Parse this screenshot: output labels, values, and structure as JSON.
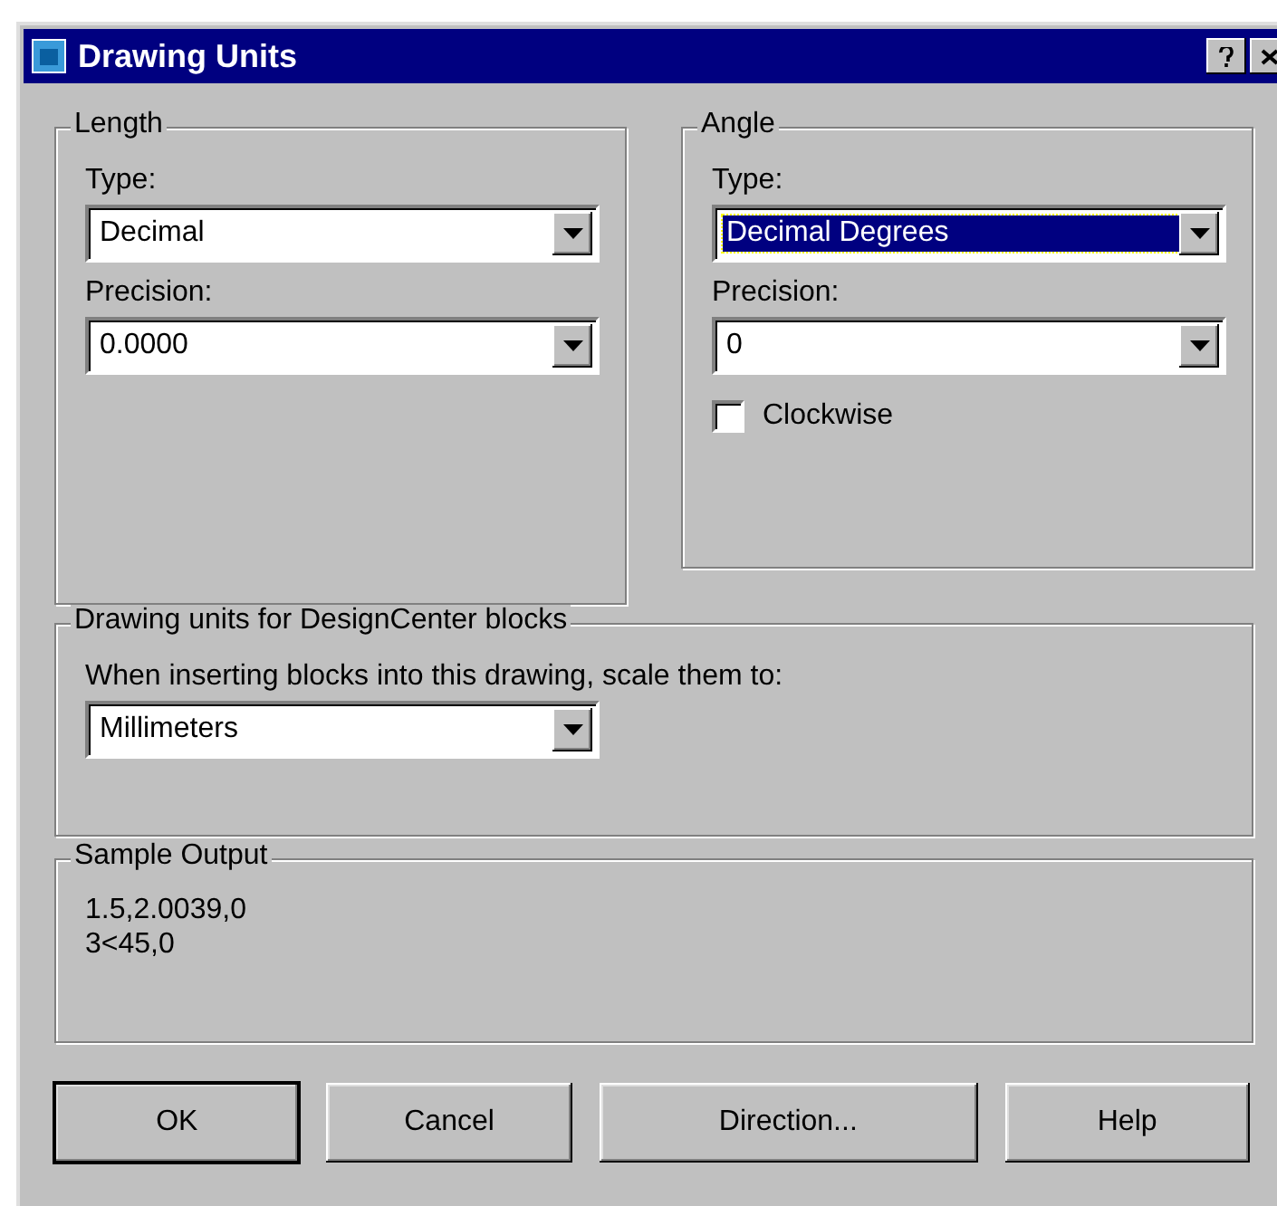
{
  "window": {
    "title": "Drawing Units"
  },
  "length": {
    "title": "Length",
    "fields": [
      {
        "label": "Type:",
        "value": "Decimal",
        "selected": false
      },
      {
        "label": "Precision:",
        "value": "0.0000",
        "selected": false
      }
    ]
  },
  "angle": {
    "title": "Angle",
    "fields": [
      {
        "label": "Type:",
        "value": "Decimal Degrees",
        "selected": true
      },
      {
        "label": "Precision:",
        "value": "0",
        "selected": false
      }
    ],
    "clockwise": {
      "label": "Clockwise",
      "checked": false
    }
  },
  "designcenter": {
    "title": "Drawing units for DesignCenter blocks",
    "label": "When inserting blocks into this drawing, scale them to:",
    "value": "Millimeters",
    "selected": false
  },
  "sample_output": {
    "title": "Sample Output",
    "lines": [
      "1.5,2.0039,0",
      "3<45,0"
    ]
  },
  "buttons": [
    {
      "label": "OK",
      "default": true
    },
    {
      "label": "Cancel",
      "default": false
    },
    {
      "label": "Direction...",
      "default": false
    },
    {
      "label": "Help",
      "default": false
    }
  ]
}
